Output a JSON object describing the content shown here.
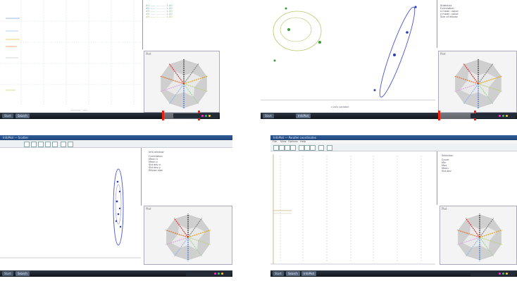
{
  "taskbar": {
    "start_label": "Start",
    "search_label": "Search",
    "app_label": "InfoPlot",
    "colors": {
      "bar": "#1a222c",
      "highlight": "#e2231a"
    }
  },
  "radar": {
    "caption": "Plot",
    "line_colors": [
      "#222222",
      "#7a7a7a",
      "#e0a000",
      "#b8d080",
      "#9bd59b",
      "#2f6de0",
      "#8fb7e8",
      "#d6a6e0",
      "#e06a1a",
      "#e02020"
    ],
    "fill_color": "#cfcfcf"
  },
  "q1": {
    "legend_rows": [
      "#1 —— ............  1.00",
      "#2 —— ............  1.00",
      "#3 —— ............  1.00",
      "#4 —— ............  1.00",
      "#5 —— ............  1.00"
    ]
  },
  "q2": {
    "info_rows": [
      "Statistics",
      "Correlation",
      "x mean: value",
      "y mean: value",
      "Size of ellipse"
    ],
    "x_label": "x axis variable"
  },
  "q3": {
    "title": "InfoPlot — Scatter",
    "info_rows": [
      "Info window",
      "Correlation",
      "Mean x",
      "Mean y",
      "Std dev x",
      "Std dev y",
      "Ellipse size"
    ]
  },
  "q4": {
    "title": "InfoPlot — Parallel coordinates",
    "menu": [
      "File",
      "View",
      "Options",
      "Help"
    ],
    "info_rows": [
      "Selection",
      "Count",
      "Min",
      "Max",
      "Mean",
      "Std dev"
    ]
  }
}
